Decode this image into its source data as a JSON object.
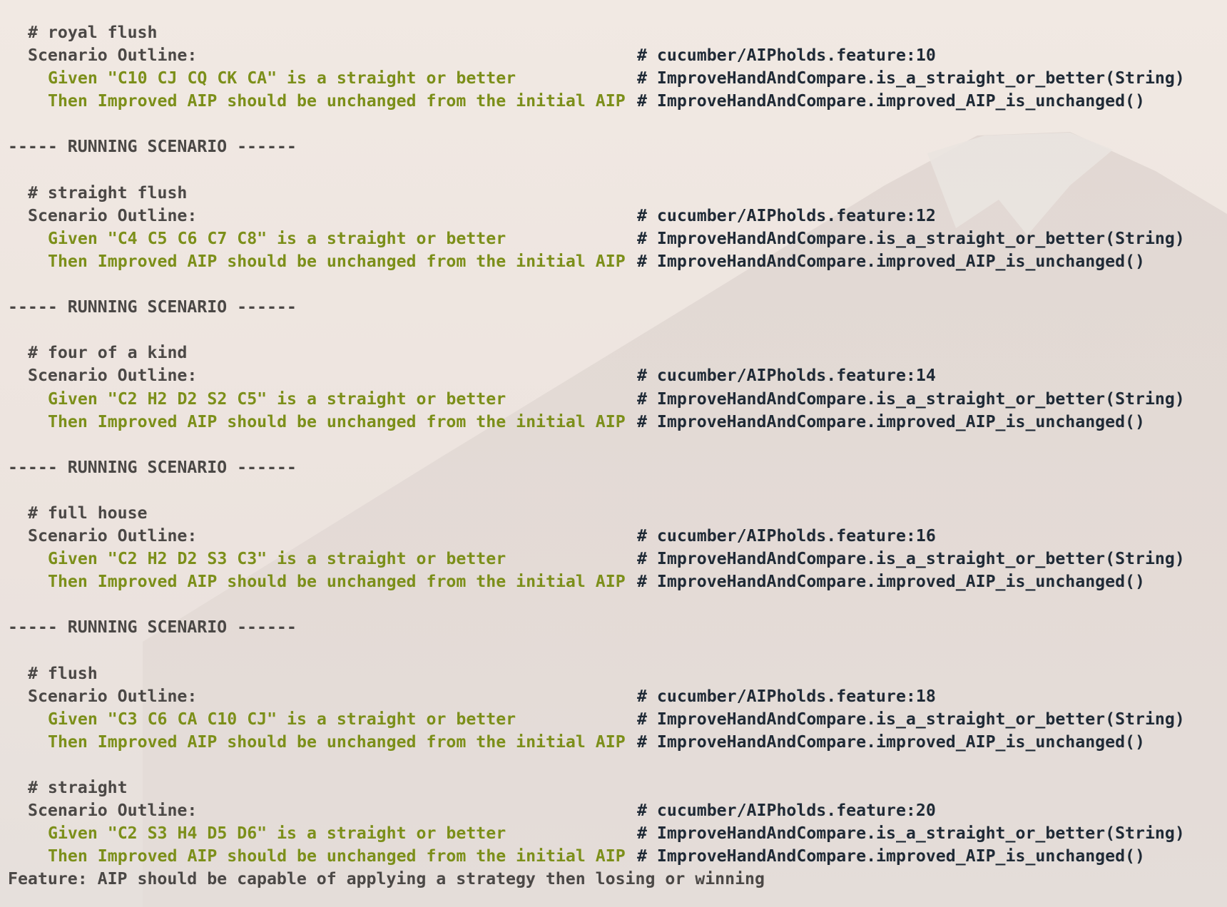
{
  "window": {
    "title": ""
  },
  "theme": {
    "background": "#ebe3dd",
    "text": "#4b4846",
    "step_color": "#7c8f1a",
    "comment_color": "#1f2a36"
  },
  "terminal": {
    "running_banner": "----- RUNNING SCENARIO ------",
    "scenario_keyword": "Scenario Outline:",
    "then_text": "Then Improved AIP should be unchanged from the initial AIP",
    "given_def": "# ImproveHandAndCompare.is_a_straight_or_better(String)",
    "then_def": "# ImproveHandAndCompare.improved_AIP_is_unchanged()",
    "scenarios": [
      {
        "comment": "# royal flush",
        "location": "# cucumber/AIPholds.feature:10",
        "given": "Given \"C10 CJ CQ CK CA\" is a straight or better"
      },
      {
        "comment": "# straight flush",
        "location": "# cucumber/AIPholds.feature:12",
        "given": "Given \"C4 C5 C6 C7 C8\" is a straight or better"
      },
      {
        "comment": "# four of a kind",
        "location": "# cucumber/AIPholds.feature:14",
        "given": "Given \"C2 H2 D2 S2 C5\" is a straight or better"
      },
      {
        "comment": "# full house",
        "location": "# cucumber/AIPholds.feature:16",
        "given": "Given \"C2 H2 D2 S3 C3\" is a straight or better"
      },
      {
        "comment": "# flush",
        "location": "# cucumber/AIPholds.feature:18",
        "given": "Given \"C3 C6 CA C10 CJ\" is a straight or better"
      },
      {
        "comment": "# straight",
        "location": "# cucumber/AIPholds.feature:20",
        "given": "Given \"C2 S3 H4 D5 D6\" is a straight or better"
      }
    ],
    "feature_line": "Feature: AIP should be capable of applying a strategy then losing or winning"
  }
}
